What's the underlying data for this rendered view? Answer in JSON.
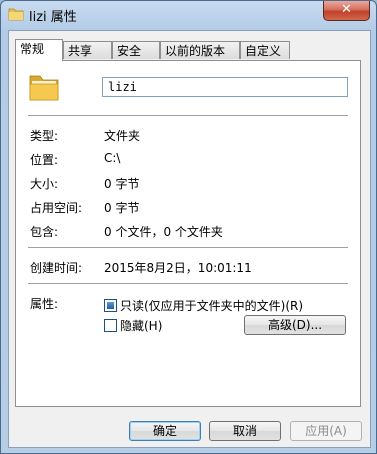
{
  "window": {
    "title": "lizi 属性",
    "folder_icon": "folder-icon",
    "close_glyph": "✕"
  },
  "tabs": [
    {
      "label": "常规",
      "active": true
    },
    {
      "label": "共享",
      "active": false
    },
    {
      "label": "安全",
      "active": false
    },
    {
      "label": "以前的版本",
      "active": false
    },
    {
      "label": "自定义",
      "active": false
    }
  ],
  "general": {
    "folder_name": "lizi",
    "type_label": "类型:",
    "type_value": "文件夹",
    "location_label": "位置:",
    "location_value": "C:\\",
    "size_label": "大小:",
    "size_value": "0 字节",
    "size_on_disk_label": "占用空间:",
    "size_on_disk_value": "0 字节",
    "contains_label": "包含:",
    "contains_value": "0 个文件，0 个文件夹",
    "created_label": "创建时间:",
    "created_value": "2015年8月2日，10:01:11",
    "attributes_label": "属性:",
    "readonly_label": "只读(仅应用于文件夹中的文件)(R)",
    "readonly_checked": true,
    "hidden_label": "隐藏(H)",
    "hidden_checked": false,
    "advanced_label": "高级(D)..."
  },
  "buttons": {
    "ok": "确定",
    "cancel": "取消",
    "apply": "应用(A)"
  },
  "colors": {
    "title_bar": "#b3cbe6",
    "close_button": "#c0402c",
    "default_button_border": "#3c7fb1"
  }
}
